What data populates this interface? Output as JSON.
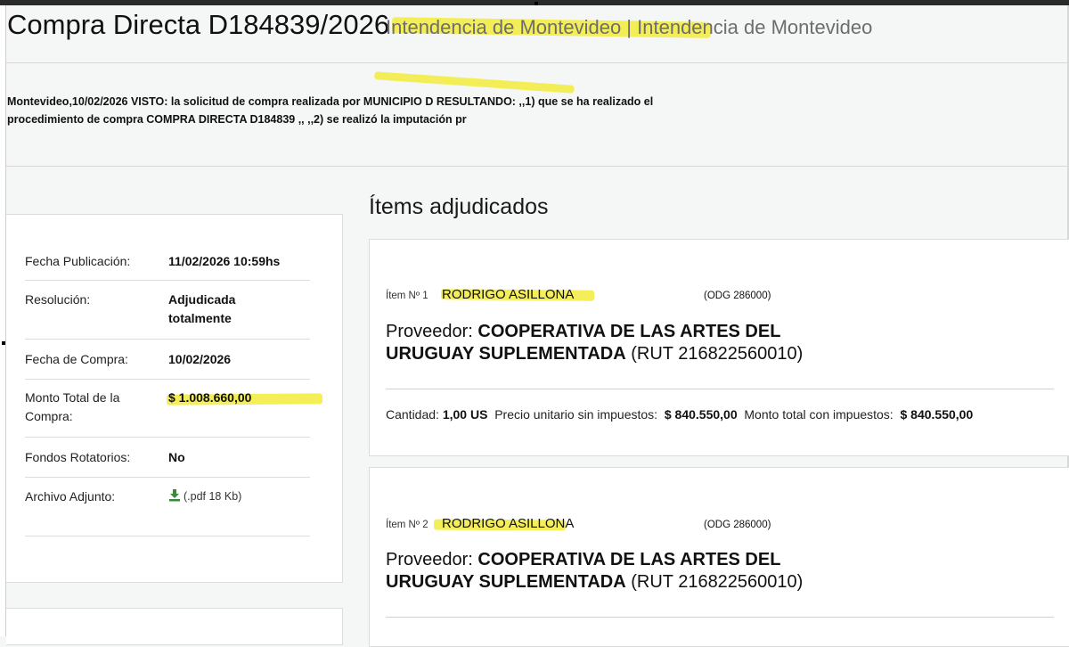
{
  "header": {
    "title": "Compra Directa D184839/2026",
    "organization": "Intendencia de Montevideo | Intendencia de Montevideo"
  },
  "description": {
    "line1": "Montevideo,10/02/2026 VISTO: la solicitud de compra realizada por MUNICIPIO D RESULTANDO: ,,1) que se ha realizado el",
    "line2": "procedimiento de compra COMPRA DIRECTA D184839 ,, ,,2) se realizó la imputación pr"
  },
  "details": {
    "fecha_publicacion_label": "Fecha Publicación:",
    "fecha_publicacion": "11/02/2026 10:59hs",
    "resolucion_label": "Resolución:",
    "resolucion_1": "Adjudicada",
    "resolucion_2": "totalmente",
    "fecha_compra_label": "Fecha de Compra:",
    "fecha_compra": "10/02/2026",
    "monto_label_1": "Monto Total de la",
    "monto_label_2": "Compra:",
    "monto": "$ 1.008.660,00",
    "fondos_label": "Fondos Rotatorios:",
    "fondos": "No",
    "archivo_label": "Archivo Adjunto:",
    "archivo": "(.pdf 18 Kb)"
  },
  "items_title": "Ítems adjudicados",
  "items": [
    {
      "number": "Ítem Nº 1",
      "name": "RODRIGO ASILLONA",
      "odg": "(ODG 286000)",
      "prov_label": "Proveedor:",
      "prov_name_1": "COOPERATIVA DE LAS ARTES DEL",
      "prov_name_2": "URUGUAY SUPLEMENTADA",
      "rut": "(RUT 216822560010)",
      "cantidad_label": "Cantidad:",
      "cantidad": "1,00 US",
      "precio_label": "Precio unitario sin impuestos:",
      "precio": "$ 840.550,00",
      "monto_label": "Monto total con impuestos:",
      "monto": "$ 840.550,00"
    },
    {
      "number": "Ítem Nº 2",
      "name": "RODRIGO ASILLONA",
      "odg": "(ODG 286000)",
      "prov_label": "Proveedor:",
      "prov_name_1": "COOPERATIVA DE LAS ARTES DEL",
      "prov_name_2": "URUGUAY SUPLEMENTADA",
      "rut": "(RUT 216822560010)"
    }
  ],
  "colors": {
    "highlight": "#f2ec3c",
    "download_icon": "#3a8a3a"
  }
}
